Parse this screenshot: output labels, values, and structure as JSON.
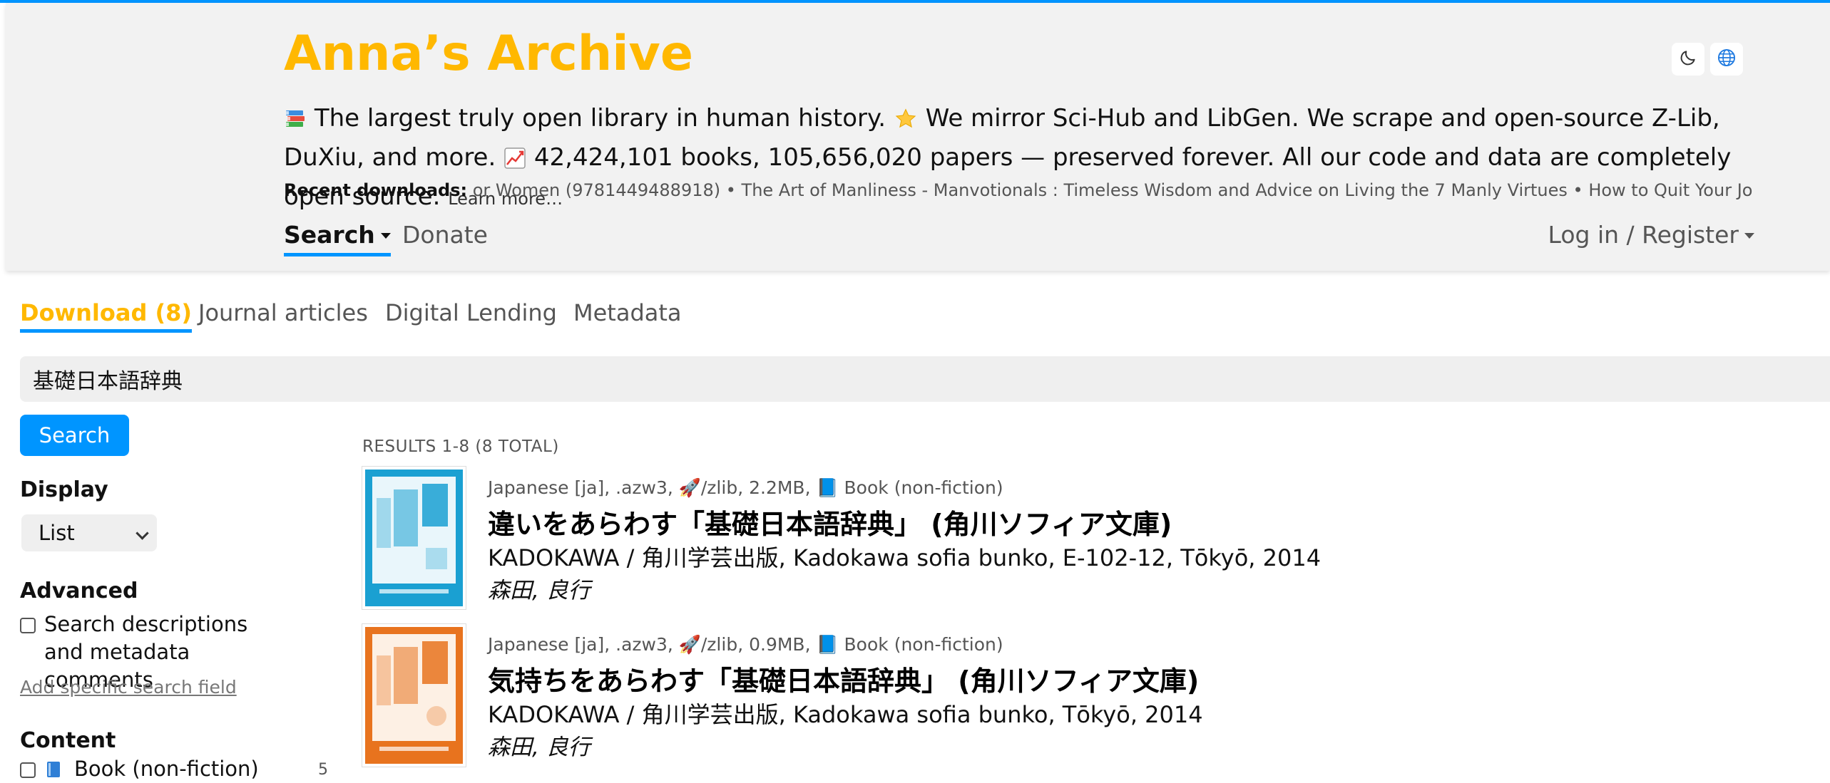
{
  "header": {
    "logo": "Anna’s Archive",
    "tagline_part1": "The largest truly open library in human history.",
    "tagline_part2": "We mirror Sci-Hub and LibGen. We scrape and open-source Z-Lib, DuXiu, and more.",
    "tagline_part3": "42,424,101 books, 105,656,020 papers — preserved forever. All our code and data are completely open source.",
    "learn_more": "Learn more…",
    "recent_label": "Recent downloads:",
    "recent_text": "or Women (9781449488918) • The Art of Manliness - Manvotionals : Timeless Wisdom and Advice on Living the 7 Manly Virtues • How to Quit Your Job with P"
  },
  "nav": {
    "search": "Search",
    "donate": "Donate",
    "login": "Log in / Register"
  },
  "tabs": [
    {
      "label": "Download (8)",
      "active": true
    },
    {
      "label": "Journal articles",
      "active": false
    },
    {
      "label": "Digital Lending",
      "active": false
    },
    {
      "label": "Metadata",
      "active": false
    }
  ],
  "search": {
    "value": "基礎日本語辞典",
    "button": "Search"
  },
  "sidebar": {
    "display_heading": "Display",
    "display_value": "List",
    "advanced_heading": "Advanced",
    "descriptions_label": "Search descriptions and metadata comments",
    "add_field": "Add specific search field",
    "content_heading": "Content",
    "content_items": [
      {
        "label": "Book (non-fiction)",
        "count": "5"
      }
    ]
  },
  "results": {
    "label": "RESULTS 1-8 (8 TOTAL)",
    "items": [
      {
        "meta": "Japanese [ja], .azw3, 🚀/zlib, 2.2MB, 📘 Book (non-fiction)",
        "title": "違いをあらわす「基礎日本語辞典」 (角川ソフィア文庫)",
        "publisher": "KADOKAWA / 角川学芸出版, Kadokawa sofia bunko, E-102-12, Tōkyō, 2014",
        "author": "森田, 良行",
        "cover_color": "#1aa0d2"
      },
      {
        "meta": "Japanese [ja], .azw3, 🚀/zlib, 0.9MB, 📘 Book (non-fiction)",
        "title": "気持ちをあらわす「基礎日本語辞典」 (角川ソフィア文庫)",
        "publisher": "KADOKAWA / 角川学芸出版, Kadokawa sofia bunko, Tōkyō, 2014",
        "author": "森田, 良行",
        "cover_color": "#e8731e"
      }
    ]
  },
  "colors": {
    "accent_blue": "#0095ff",
    "brand_yellow": "#ffb800"
  }
}
